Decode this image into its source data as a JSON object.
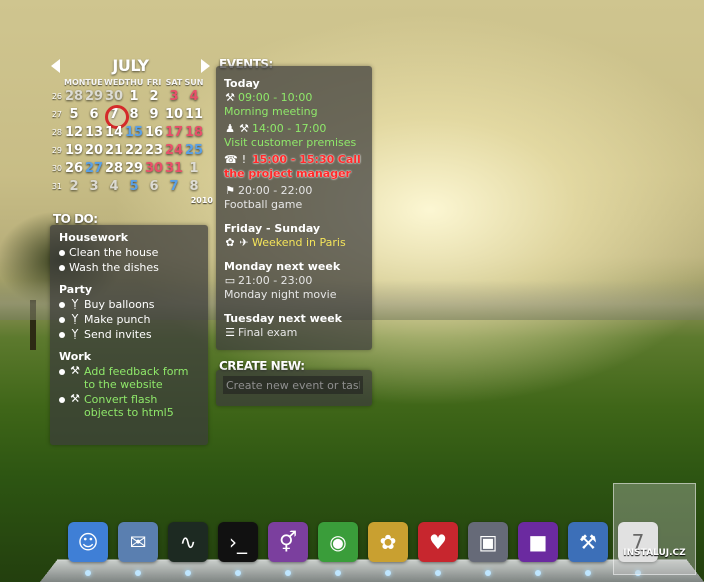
{
  "calendar": {
    "month": "JULY",
    "year": "2010",
    "dows": [
      "MON",
      "TUE",
      "WED",
      "THU",
      "FRI",
      "SAT",
      "SUN"
    ],
    "weeks": [
      {
        "wk": "26",
        "days": [
          {
            "d": "28",
            "c": "other"
          },
          {
            "d": "29",
            "c": "other"
          },
          {
            "d": "30",
            "c": "other"
          },
          {
            "d": "1",
            "c": ""
          },
          {
            "d": "2",
            "c": ""
          },
          {
            "d": "3",
            "c": "red"
          },
          {
            "d": "4",
            "c": "red"
          }
        ]
      },
      {
        "wk": "27",
        "days": [
          {
            "d": "5",
            "c": ""
          },
          {
            "d": "6",
            "c": ""
          },
          {
            "d": "7",
            "c": "today"
          },
          {
            "d": "8",
            "c": ""
          },
          {
            "d": "9",
            "c": ""
          },
          {
            "d": "10",
            "c": ""
          },
          {
            "d": "11",
            "c": ""
          }
        ]
      },
      {
        "wk": "28",
        "days": [
          {
            "d": "12",
            "c": ""
          },
          {
            "d": "13",
            "c": ""
          },
          {
            "d": "14",
            "c": ""
          },
          {
            "d": "15",
            "c": "blue"
          },
          {
            "d": "16",
            "c": ""
          },
          {
            "d": "17",
            "c": "red"
          },
          {
            "d": "18",
            "c": "red"
          }
        ]
      },
      {
        "wk": "29",
        "days": [
          {
            "d": "19",
            "c": ""
          },
          {
            "d": "20",
            "c": ""
          },
          {
            "d": "21",
            "c": ""
          },
          {
            "d": "22",
            "c": ""
          },
          {
            "d": "23",
            "c": ""
          },
          {
            "d": "24",
            "c": "red"
          },
          {
            "d": "25",
            "c": "blue"
          }
        ]
      },
      {
        "wk": "30",
        "days": [
          {
            "d": "26",
            "c": ""
          },
          {
            "d": "27",
            "c": "blue"
          },
          {
            "d": "28",
            "c": ""
          },
          {
            "d": "29",
            "c": ""
          },
          {
            "d": "30",
            "c": "red"
          },
          {
            "d": "31",
            "c": "red"
          },
          {
            "d": "1",
            "c": "other"
          }
        ]
      },
      {
        "wk": "31",
        "days": [
          {
            "d": "2",
            "c": "other"
          },
          {
            "d": "3",
            "c": "other"
          },
          {
            "d": "4",
            "c": "other"
          },
          {
            "d": "5",
            "c": "blue"
          },
          {
            "d": "6",
            "c": "other"
          },
          {
            "d": "7",
            "c": "blue"
          },
          {
            "d": "8",
            "c": "other"
          }
        ]
      }
    ]
  },
  "todo": {
    "title": "TO DO:",
    "groups": [
      {
        "title": "Housework",
        "items": [
          {
            "text": "Clean the house",
            "icon": "",
            "green": false
          },
          {
            "text": "Wash the dishes",
            "icon": "",
            "green": false
          }
        ]
      },
      {
        "title": "Party",
        "items": [
          {
            "text": "Buy balloons",
            "icon": "cocktail-icon",
            "green": false
          },
          {
            "text": "Make punch",
            "icon": "cocktail-icon",
            "green": false
          },
          {
            "text": "Send invites",
            "icon": "cocktail-icon",
            "green": false
          }
        ]
      },
      {
        "title": "Work",
        "items": [
          {
            "text": "Add feedback form to the website",
            "icon": "tools-icon",
            "green": true
          },
          {
            "text": "Convert flash objects to html5",
            "icon": "tools-icon",
            "green": true
          }
        ]
      }
    ]
  },
  "events": {
    "title": "EVENTS:",
    "groups": [
      {
        "title": "Today",
        "items": [
          {
            "time": "09:00 - 10:00",
            "text": "Morning meeting",
            "icons": [
              "tools-icon"
            ],
            "style": "green"
          },
          {
            "time": "14:00 - 17:00",
            "text": "Visit customer premises",
            "icons": [
              "person-icon",
              "tools-icon"
            ],
            "style": "green"
          },
          {
            "time": "15:00 - 15:30",
            "text": "Call the project manager",
            "icons": [
              "phone-icon",
              "alert-icon"
            ],
            "style": "urgent"
          },
          {
            "time": "20:00 - 22:00",
            "text": "Football game",
            "icons": [
              "runner-icon"
            ],
            "style": "muted"
          }
        ]
      },
      {
        "title": "Friday - Sunday",
        "items": [
          {
            "time": "",
            "text": "Weekend in Paris",
            "icons": [
              "flower-icon",
              "plane-icon"
            ],
            "style": "yellow"
          }
        ]
      },
      {
        "title": "Monday next week",
        "items": [
          {
            "time": "21:00 - 23:00",
            "text": "Monday night movie",
            "icons": [
              "tv-icon"
            ],
            "style": "muted"
          }
        ]
      },
      {
        "title": "Tuesday next week",
        "items": [
          {
            "time": "",
            "text": "Final exam",
            "icons": [
              "books-icon"
            ],
            "style": "muted"
          }
        ]
      }
    ]
  },
  "create": {
    "title": "CREATE NEW:",
    "placeholder": "Create new event or task"
  },
  "dock": [
    {
      "name": "finder-icon",
      "glyph": "☺",
      "color": "#3f7fd6"
    },
    {
      "name": "mail-icon",
      "glyph": "✉",
      "color": "#5a7fb0"
    },
    {
      "name": "activity-monitor-icon",
      "glyph": "∿",
      "color": "#1d2a22"
    },
    {
      "name": "terminal-icon",
      "glyph": "›_",
      "color": "#111111"
    },
    {
      "name": "gender-app-icon",
      "glyph": "⚥",
      "color": "#7b3f9e"
    },
    {
      "name": "chrome-icon",
      "glyph": "◉",
      "color": "#3a9d3a"
    },
    {
      "name": "cyberduck-icon",
      "glyph": "✿",
      "color": "#c9a030"
    },
    {
      "name": "strawberry-icon",
      "glyph": "♥",
      "color": "#c7262e"
    },
    {
      "name": "vmware-icon",
      "glyph": "▣",
      "color": "#666a78"
    },
    {
      "name": "purple-box-icon",
      "glyph": "■",
      "color": "#6b2aa0"
    },
    {
      "name": "xcode-icon",
      "glyph": "⚒",
      "color": "#3c6fb8"
    },
    {
      "name": "calendar-app-icon",
      "glyph": "7",
      "color": "#eeeeee"
    }
  ],
  "watermark": "INSTALUJ.CZ",
  "icon_glyphs": {
    "tools-icon": "⚒",
    "cocktail-icon": "Ỵ",
    "person-icon": "♟",
    "phone-icon": "☎",
    "alert-icon": "!",
    "runner-icon": "⚑",
    "flower-icon": "✿",
    "plane-icon": "✈",
    "tv-icon": "▭",
    "books-icon": "☰"
  }
}
